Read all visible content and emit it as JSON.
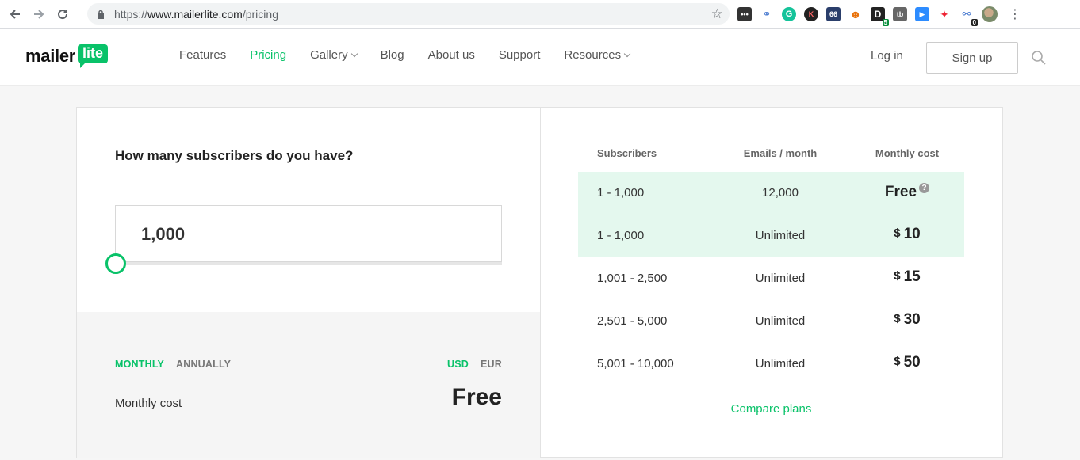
{
  "browser": {
    "url_prefix": "https://",
    "url_host": "www.mailerlite.com",
    "url_path": "/pricing",
    "ext_badges": [
      "5",
      "0"
    ],
    "ext_labels": [
      "K",
      "66",
      "tb"
    ]
  },
  "header": {
    "logo_main": "mailer",
    "logo_bubble": "lite",
    "nav": [
      {
        "label": "Features",
        "active": false
      },
      {
        "label": "Pricing",
        "active": true
      },
      {
        "label": "Gallery",
        "active": false,
        "dropdown": true
      },
      {
        "label": "Blog",
        "active": false
      },
      {
        "label": "About us",
        "active": false
      },
      {
        "label": "Support",
        "active": false
      },
      {
        "label": "Resources",
        "active": false,
        "dropdown": true
      }
    ],
    "login": "Log in",
    "signup": "Sign up"
  },
  "calculator": {
    "question": "How many subscribers do you have?",
    "subscribers_value": "1,000",
    "slider_level": 0,
    "billing_monthly": "MONTHLY",
    "billing_annually": "ANNUALLY",
    "currency_usd": "USD",
    "currency_eur": "EUR",
    "cost_label": "Monthly cost",
    "cost_value": "Free"
  },
  "table": {
    "headers": [
      "Subscribers",
      "Emails / month",
      "Monthly cost"
    ],
    "rows": [
      {
        "subscribers": "1  -  1,000",
        "emails": "12,000",
        "currency": "",
        "cost": "Free",
        "highlighted": true,
        "help": "?"
      },
      {
        "subscribers": "1  -  1,000",
        "emails": "Unlimited",
        "currency": "$",
        "cost": "10",
        "highlighted": true
      },
      {
        "subscribers": "1,001  -  2,500",
        "emails": "Unlimited",
        "currency": "$",
        "cost": "15",
        "highlighted": false
      },
      {
        "subscribers": "2,501  -  5,000",
        "emails": "Unlimited",
        "currency": "$",
        "cost": "30",
        "highlighted": false
      },
      {
        "subscribers": "5,001  -  10,000",
        "emails": "Unlimited",
        "currency": "$",
        "cost": "50",
        "highlighted": false
      }
    ],
    "compare": "Compare plans"
  },
  "colors": {
    "accent": "#09c269",
    "highlight_row": "#e4f8ee"
  }
}
